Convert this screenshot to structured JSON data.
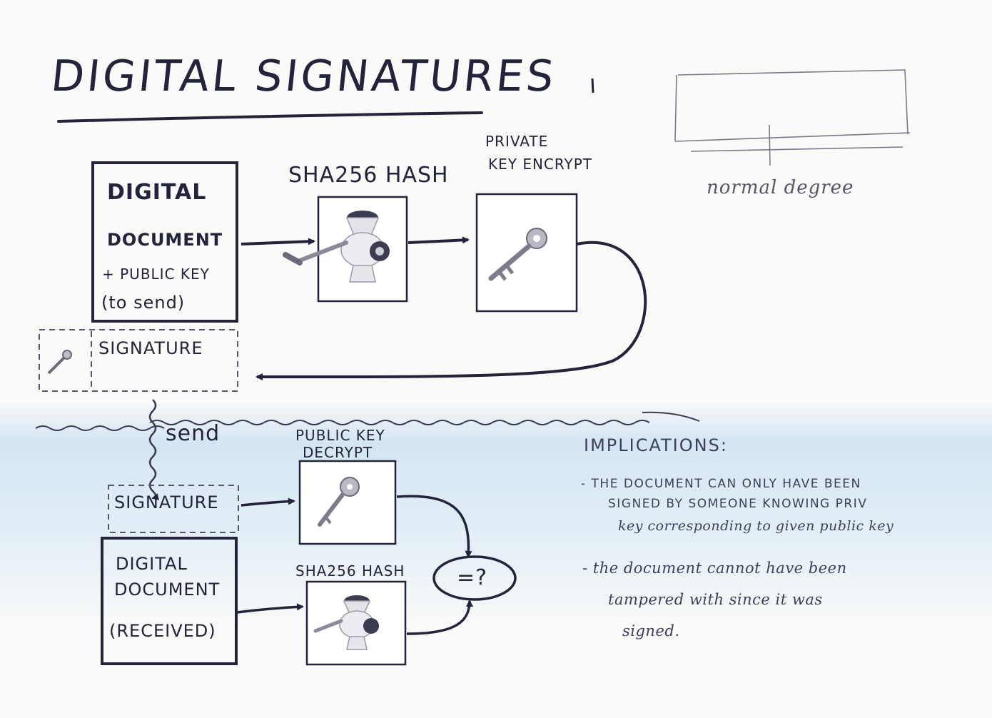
{
  "title": "DIGITAL SIGNATURES",
  "doc_box": {
    "line1": "DIGITAL",
    "line2": "DOCUMENT",
    "line3": "+ PUBLIC KEY",
    "line4": "(to send)"
  },
  "sha_hash_label": "SHA256 HASH",
  "private_key_label": {
    "line1": "PRIVATE",
    "line2": "KEY ENCRYPT"
  },
  "signature_label": "SIGNATURE",
  "send_label": "send",
  "public_key_label": {
    "line1": "PUBLIC KEY",
    "line2": "DECRYPT"
  },
  "received_signature_label": "SIGNATURE",
  "received_doc": {
    "line1": "DIGITAL",
    "line2": "DOCUMENT",
    "line3": "(RECEIVED)"
  },
  "received_hash_label": "SHA256 HASH",
  "compare_label": "=?",
  "normal_scale_label": "normal degree",
  "implications": {
    "heading": "IMPLICATIONS:",
    "item1_line1": "- THE DOCUMENT CAN ONLY HAVE BEEN",
    "item1_line2": "SIGNED BY SOMEONE KNOWING PRIV",
    "item1_line3": "key corresponding to given public key",
    "item2_line1": "- the document cannot have been",
    "item2_line2": "tampered with since it was",
    "item2_line3": "signed."
  }
}
